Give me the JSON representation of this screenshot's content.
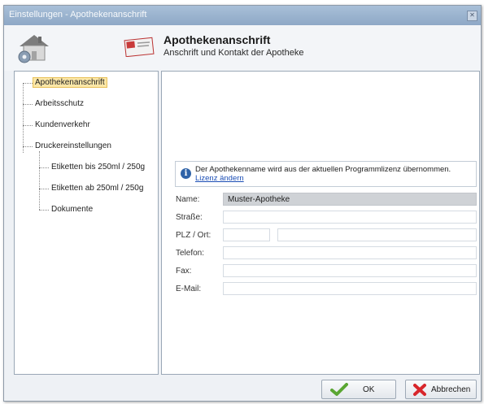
{
  "window": {
    "title": "Einstellungen - Apothekenanschrift"
  },
  "header": {
    "title": "Apothekenanschrift",
    "subtitle": "Anschrift und Kontakt der Apotheke"
  },
  "nav": {
    "items": [
      {
        "label": "Apothekenanschrift",
        "selected": true
      },
      {
        "label": "Arbeitsschutz"
      },
      {
        "label": "Kundenverkehr"
      },
      {
        "label": "Druckereinstellungen"
      },
      {
        "label": "Etiketten bis 250ml / 250g"
      },
      {
        "label": "Etiketten ab 250ml / 250g"
      },
      {
        "label": "Dokumente"
      }
    ]
  },
  "info": {
    "text": "Der Apothekenname wird aus der aktuellen Programmlizenz übernommen.",
    "link": "Lizenz ändern"
  },
  "form": {
    "name_label": "Name:",
    "name_value": "Muster-Apotheke",
    "strasse_label": "Straße:",
    "strasse_value": "",
    "plz_label": "PLZ / Ort:",
    "plz_value": "",
    "ort_value": "",
    "telefon_label": "Telefon:",
    "telefon_value": "",
    "fax_label": "Fax:",
    "fax_value": "",
    "email_label": "E-Mail:",
    "email_value": ""
  },
  "buttons": {
    "ok": "OK",
    "cancel": "Abbrechen"
  },
  "icons": {
    "close": "close-icon",
    "house": "house-settings-icon",
    "card": "address-card-icon",
    "info": "info-icon",
    "ok": "checkmark-icon",
    "cancel": "x-icon"
  },
  "colors": {
    "selection": "#fbe7a8",
    "titlebar": "#9fb6d0",
    "link": "#1a4db5"
  }
}
